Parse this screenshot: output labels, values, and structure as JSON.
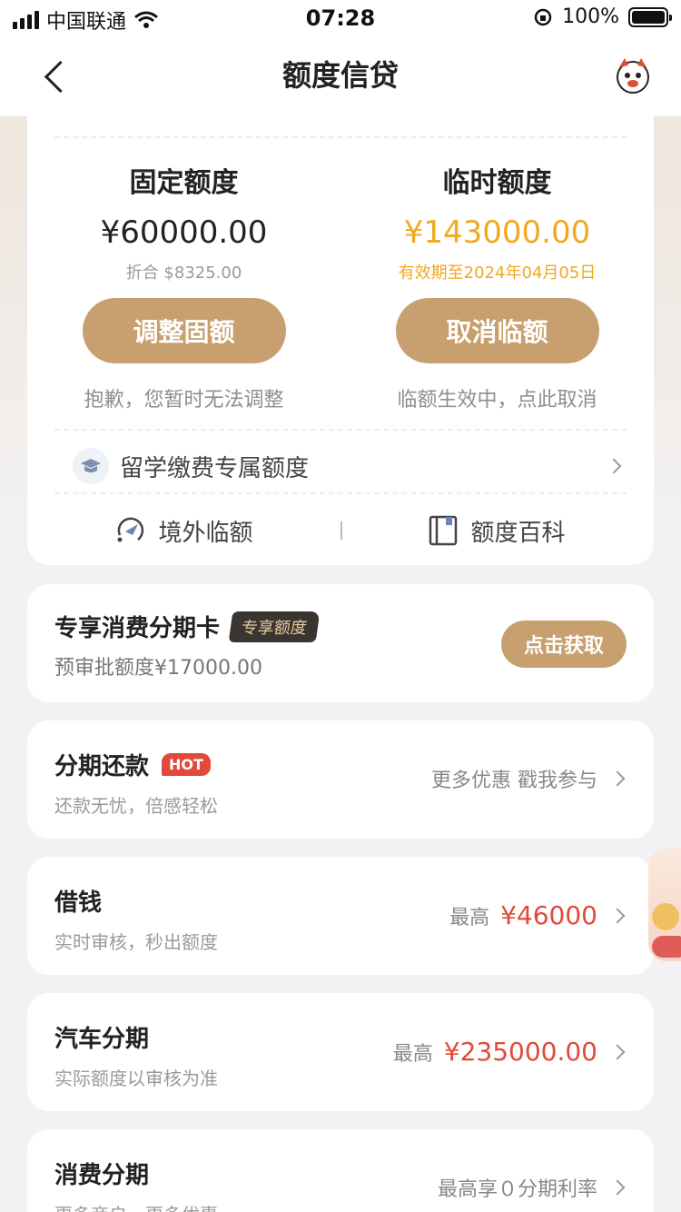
{
  "status_bar": {
    "carrier": "中国联通",
    "time": "07:28",
    "battery": "100%"
  },
  "nav": {
    "title": "额度信贷"
  },
  "limits": {
    "fixed": {
      "label": "固定额度",
      "amount": "¥60000.00",
      "sub": "折合 $8325.00",
      "button": "调整固额",
      "note": "抱歉，您暂时无法调整"
    },
    "temp": {
      "label": "临时额度",
      "amount": "¥143000.00",
      "sub": "有效期至2024年04月05日",
      "button": "取消临额",
      "note": "临额生效中，点此取消"
    },
    "study": {
      "label": "留学缴费专属额度"
    },
    "tools": [
      {
        "label": "境外临额",
        "icon": "plane-circle-icon"
      },
      {
        "label": "额度百科",
        "icon": "book-icon"
      }
    ]
  },
  "promo": {
    "title": "专享消费分期卡",
    "tag": "专享额度",
    "sub": "预审批额度¥17000.00",
    "button": "点击获取"
  },
  "services": [
    {
      "title": "分期还款",
      "badge": "HOT",
      "sub": "还款无忧，倍感轻松",
      "right_text": "更多优惠 戳我参与",
      "value": ""
    },
    {
      "title": "借钱",
      "badge": "",
      "sub": "实时审核，秒出额度",
      "right_text": "最高",
      "value": "¥46000"
    },
    {
      "title": "汽车分期",
      "badge": "",
      "sub": "实际额度以审核为准",
      "right_text": "最高",
      "value": "¥235000.00"
    },
    {
      "title": "消费分期",
      "badge": "",
      "sub": "更多商户，更多优惠",
      "right_text": "最高享０分期利率",
      "value": ""
    }
  ],
  "colors": {
    "accent": "#c8a06f",
    "gold": "#f0a91e",
    "red": "#e04b3a"
  }
}
